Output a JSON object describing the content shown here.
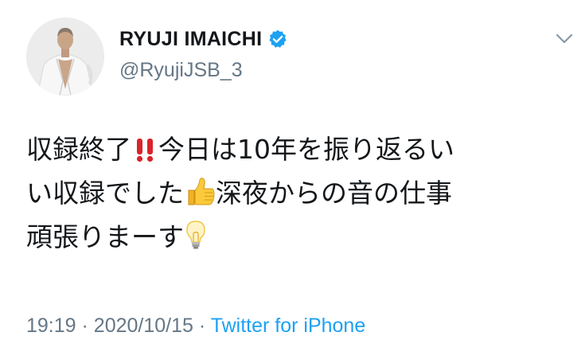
{
  "author": {
    "display_name": "RYUJI IMAICHI",
    "handle": "@RyujiJSB_3",
    "verified": true
  },
  "icons": {
    "verified": "verified-badge-icon",
    "menu": "chevron-down-icon",
    "emoji_1": "double-exclamation-emoji",
    "emoji_2": "thumbs-up-emoji",
    "emoji_3": "light-bulb-emoji"
  },
  "tweet": {
    "line1_text_a": "収録終了",
    "line1_text_b": "今日は10年を振り返るい",
    "line2_text_a": "い収録でした",
    "line2_text_b": "深夜からの音の仕事",
    "line3_text_a": "頑張りまーす"
  },
  "meta": {
    "time": "19:19",
    "separator": "·",
    "date": "2020/10/15",
    "source": "Twitter for iPhone"
  },
  "colors": {
    "text": "#14171a",
    "secondary": "#657786",
    "link": "#1da1f2",
    "verified": "#1da1f2",
    "exclamation": "#d9242b"
  }
}
